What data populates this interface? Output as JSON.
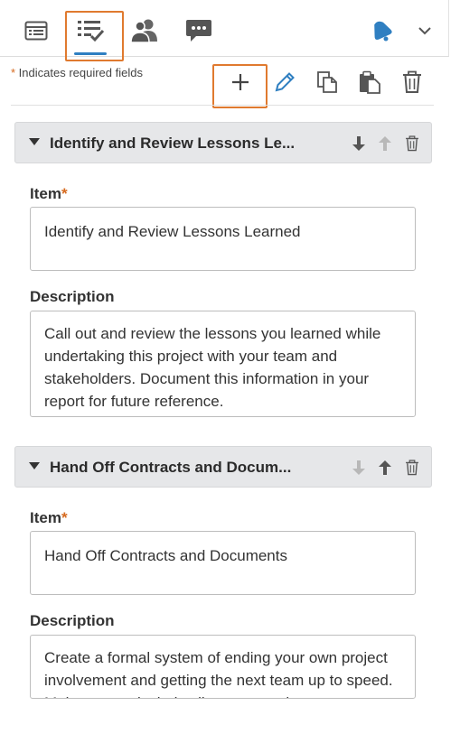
{
  "toolbar_tabs": [
    {
      "icon": "list-grid-icon"
    },
    {
      "icon": "checklist-icon"
    },
    {
      "icon": "users-icon"
    },
    {
      "icon": "chat-icon"
    }
  ],
  "header_right": {
    "bell_icon": "bell-icon",
    "menu_icon": "chevron-down-icon"
  },
  "required_note": {
    "star": "*",
    "text": " Indicates required fields"
  },
  "actions": [
    "add-icon",
    "pencil-icon",
    "copy-icon",
    "paste-icon",
    "trash-icon"
  ],
  "colors": {
    "accent": "#2f7fc1",
    "highlight": "#e07a2f",
    "header_bg": "#e6e7e9",
    "required": "#d66a1f"
  },
  "items": [
    {
      "header_title": "Identify and Review Lessons Le...",
      "item_label": "Item",
      "item_required": "*",
      "item_value": "Identify and Review Lessons Learned",
      "description_label": "Description",
      "description_value": "Call out and review the lessons you learned while undertaking this project with your team and stakeholders. Document this information in your report for future reference."
    },
    {
      "header_title": "Hand Off Contracts and Docum...",
      "item_label": "Item",
      "item_required": "*",
      "item_value": "Hand Off Contracts and Documents",
      "description_label": "Description",
      "description_value": "Create a formal system of ending your own project involvement and getting the next team up to speed. Make sure to include client approval."
    }
  ]
}
